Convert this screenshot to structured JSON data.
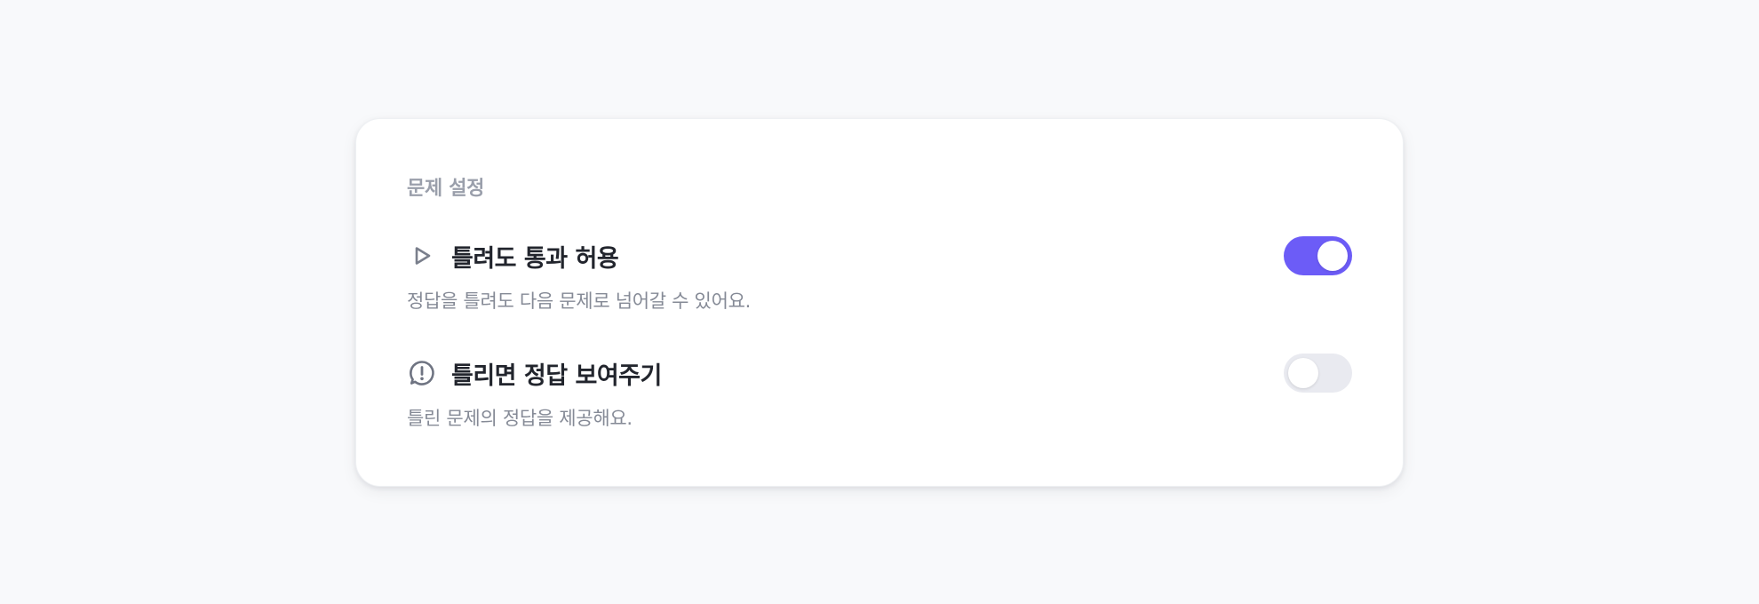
{
  "settings_card": {
    "section_title": "문제 설정",
    "accent_color": "#6c5cf7",
    "items": [
      {
        "icon": "play-icon",
        "title": "틀려도 통과 허용",
        "description": "정답을 틀려도 다음 문제로 넘어갈 수 있어요.",
        "enabled": true
      },
      {
        "icon": "alert-speech-icon",
        "title": "틀리면 정답 보여주기",
        "description": "틀린 문제의 정답을 제공해요.",
        "enabled": false
      }
    ]
  }
}
